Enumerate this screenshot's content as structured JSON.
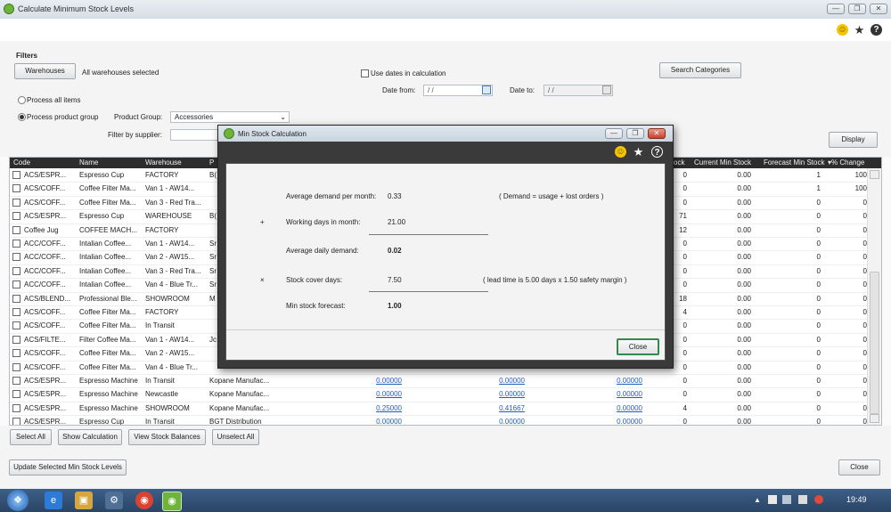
{
  "window": {
    "title": "Calculate Minimum Stock Levels"
  },
  "filters": {
    "heading": "Filters",
    "warehouses_button": "Warehouses",
    "warehouses_status": "All warehouses selected",
    "use_dates_label": "Use dates in calculation",
    "date_from_label": "Date from:",
    "date_from_value": "/ /",
    "date_to_label": "Date to:",
    "date_to_value": "/ /",
    "search_categories_button": "Search Categories",
    "process_all_label": "Process all items",
    "process_group_label": "Process product group",
    "product_group_label": "Product Group:",
    "product_group_value": "Accessories",
    "filter_supplier_label": "Filter by supplier:",
    "display_button": "Display"
  },
  "grid": {
    "headers": {
      "code": "Code",
      "name": "Name",
      "warehouse": "Warehouse",
      "supplier": "P",
      "stock": "ock",
      "current": "Current Min Stock",
      "forecast": "Forecast Min Stock",
      "change": "▾% Change"
    },
    "rows": [
      {
        "code": "ACS/ESPR...",
        "name": "Espresso Cup",
        "warehouse": "FACTORY",
        "supplier": "B(",
        "a": "",
        "b": "",
        "c": "",
        "stock": "0",
        "current": "0.00",
        "forecast": "1",
        "change": "100"
      },
      {
        "code": "ACS/COFF...",
        "name": "Coffee Filter Ma...",
        "warehouse": "Van 1 -  AW14...",
        "supplier": "",
        "a": "",
        "b": "",
        "c": "",
        "stock": "0",
        "current": "0.00",
        "forecast": "1",
        "change": "100"
      },
      {
        "code": "ACS/COFF...",
        "name": "Coffee Filter Ma...",
        "warehouse": "Van 3 - Red Tra...",
        "supplier": "",
        "a": "",
        "b": "",
        "c": "",
        "stock": "0",
        "current": "0.00",
        "forecast": "0",
        "change": "0"
      },
      {
        "code": "ACS/ESPR...",
        "name": "Espresso Cup",
        "warehouse": "WAREHOUSE",
        "supplier": "B(",
        "a": "",
        "b": "",
        "c": "",
        "stock": "71",
        "current": "0.00",
        "forecast": "0",
        "change": "0"
      },
      {
        "code": "Coffee Jug",
        "name": "COFFEE MACH...",
        "warehouse": "FACTORY",
        "supplier": "",
        "a": "",
        "b": "",
        "c": "",
        "stock": "12",
        "current": "0.00",
        "forecast": "0",
        "change": "0"
      },
      {
        "code": "ACC/COFF...",
        "name": "Intalian Coffee...",
        "warehouse": "Van 1 -  AW14...",
        "supplier": "Sr",
        "a": "",
        "b": "",
        "c": "",
        "stock": "0",
        "current": "0.00",
        "forecast": "0",
        "change": "0"
      },
      {
        "code": "ACC/COFF...",
        "name": "Intalian Coffee...",
        "warehouse": "Van 2 -  AW15...",
        "supplier": "Sr",
        "a": "",
        "b": "",
        "c": "",
        "stock": "0",
        "current": "0.00",
        "forecast": "0",
        "change": "0"
      },
      {
        "code": "ACC/COFF...",
        "name": "Intalian Coffee...",
        "warehouse": "Van 3 - Red Tra...",
        "supplier": "Sr",
        "a": "",
        "b": "",
        "c": "",
        "stock": "0",
        "current": "0.00",
        "forecast": "0",
        "change": "0"
      },
      {
        "code": "ACC/COFF...",
        "name": "Intalian Coffee...",
        "warehouse": "Van 4 - Blue Tr...",
        "supplier": "Sr",
        "a": "",
        "b": "",
        "c": "",
        "stock": "0",
        "current": "0.00",
        "forecast": "0",
        "change": "0"
      },
      {
        "code": "ACS/BLEND...",
        "name": "Professional Ble...",
        "warehouse": "SHOWROOM",
        "supplier": "M",
        "a": "",
        "b": "",
        "c": "",
        "stock": "18",
        "current": "0.00",
        "forecast": "0",
        "change": "0"
      },
      {
        "code": "ACS/COFF...",
        "name": "Coffee Filter Ma...",
        "warehouse": "FACTORY",
        "supplier": "",
        "a": "",
        "b": "",
        "c": "",
        "stock": "4",
        "current": "0.00",
        "forecast": "0",
        "change": "0"
      },
      {
        "code": "ACS/COFF...",
        "name": "Coffee Filter Ma...",
        "warehouse": "In Transit",
        "supplier": "",
        "a": "",
        "b": "",
        "c": "",
        "stock": "0",
        "current": "0.00",
        "forecast": "0",
        "change": "0"
      },
      {
        "code": "ACS/FILTE...",
        "name": "Filter Coffee Ma...",
        "warehouse": "Van 1 -  AW14...",
        "supplier": "Jc",
        "a": "",
        "b": "",
        "c": "",
        "stock": "0",
        "current": "0.00",
        "forecast": "0",
        "change": "0"
      },
      {
        "code": "ACS/COFF...",
        "name": "Coffee Filter Ma...",
        "warehouse": "Van 2 -  AW15...",
        "supplier": "",
        "a": "",
        "b": "",
        "c": "",
        "stock": "0",
        "current": "0.00",
        "forecast": "0",
        "change": "0"
      },
      {
        "code": "ACS/COFF...",
        "name": "Coffee Filter Ma...",
        "warehouse": "Van 4 - Blue Tr...",
        "supplier": "",
        "a": "",
        "b": "",
        "c": "",
        "stock": "0",
        "current": "0.00",
        "forecast": "0",
        "change": "0"
      },
      {
        "code": "ACS/ESPR...",
        "name": "Espresso Machine",
        "warehouse": "In Transit",
        "supplier": "Kopane Manufac...",
        "a": "0.00000",
        "b": "0.00000",
        "c": "0.00000",
        "stock": "0",
        "current": "0.00",
        "forecast": "0",
        "change": "0"
      },
      {
        "code": "ACS/ESPR...",
        "name": "Espresso Machine",
        "warehouse": "Newcastle",
        "supplier": "Kopane Manufac...",
        "a": "0.00000",
        "b": "0.00000",
        "c": "0.00000",
        "stock": "0",
        "current": "0.00",
        "forecast": "0",
        "change": "0"
      },
      {
        "code": "ACS/ESPR...",
        "name": "Espresso Machine",
        "warehouse": "SHOWROOM",
        "supplier": "Kopane Manufac...",
        "a": "0.25000",
        "b": "0.41667",
        "c": "0.00000",
        "stock": "4",
        "current": "0.00",
        "forecast": "0",
        "change": "0"
      },
      {
        "code": "ACS/ESPR...",
        "name": "Espresso Cup",
        "warehouse": "In Transit",
        "supplier": "BGT Distribution",
        "a": "0.00000",
        "b": "0.00000",
        "c": "0.00000",
        "stock": "0",
        "current": "0.00",
        "forecast": "0",
        "change": "0"
      }
    ]
  },
  "buttons": {
    "select_all": "Select All",
    "show_calculation": "Show Calculation",
    "view_stock_balances": "View Stock Balances",
    "unselect_all": "Unselect All",
    "update_selected": "Update Selected Min Stock Levels",
    "close": "Close"
  },
  "modal": {
    "title": "Min Stock Calculation",
    "avg_demand_label": "Average demand per month:",
    "avg_demand_value": "0.33",
    "avg_demand_note": "( Demand = usage + lost orders )",
    "op_multiply": "×",
    "op_plus": "+",
    "working_days_label": "Working days in month:",
    "working_days_value": "21.00",
    "avg_daily_label": "Average daily demand:",
    "avg_daily_value": "0.02",
    "cover_days_label": "Stock cover days:",
    "cover_days_value": "7.50",
    "cover_days_note": "( lead time is 5.00 days x 1.50 safety margin )",
    "forecast_label": "Min stock forecast:",
    "forecast_value": "1.00",
    "close_button": "Close"
  },
  "taskbar": {
    "clock": "19:49"
  },
  "colors": {
    "accent": "#6fb43a",
    "header_bg": "#2d2d2d",
    "link": "#1f5fbf"
  }
}
